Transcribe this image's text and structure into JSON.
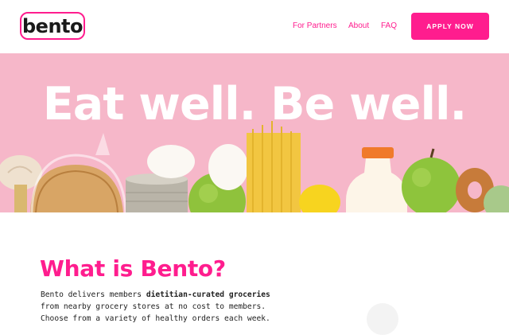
{
  "header": {
    "logo_text": "bento",
    "nav": {
      "partners": "For Partners",
      "about": "About",
      "faq": "FAQ"
    },
    "apply_label": "APPLY NOW"
  },
  "hero": {
    "title": "Eat well. Be well.",
    "background_color": "#f6b7c9"
  },
  "about": {
    "title": "What is Bento?",
    "line1_prefix": "Bento delivers members ",
    "line1_bold": "dietitian-curated groceries",
    "line2": "from nearby grocery stores at no cost to members.",
    "line3": "Choose from a variety of healthy orders each week."
  },
  "colors": {
    "brand_pink": "#ff1d8e",
    "text_dark": "#222222"
  }
}
